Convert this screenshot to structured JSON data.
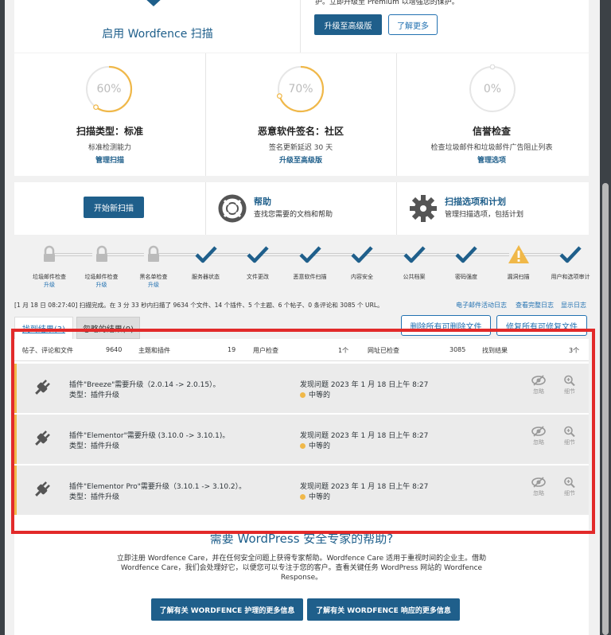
{
  "top": {
    "enable_scan": "启用 Wordfence 扫描",
    "premium_text": "护。立即升级至 Premium 以增强您的保护。",
    "upgrade_btn": "升级至高级版",
    "learn_more_btn": "了解更多"
  },
  "stats": [
    {
      "pct": "60%",
      "value": 0.6,
      "title": "扫描类型：标准",
      "sub": "标准检测能力",
      "link": "管理扫描"
    },
    {
      "pct": "70%",
      "value": 0.7,
      "title": "恶意软件签名：社区",
      "sub": "签名更新延迟 30 天",
      "link": "升级至高级版"
    },
    {
      "pct": "0%",
      "value": 0.0,
      "title": "信誉检查",
      "sub": "检查垃圾邮件和垃圾邮件广告阻止列表",
      "link": "管理选项"
    }
  ],
  "actions": {
    "start_scan": "开始新扫描",
    "help_title": "帮助",
    "help_sub": "查找您需要的文档和帮助",
    "options_title": "扫描选项和计划",
    "options_sub": "管理扫描选项，包括计划"
  },
  "steps": [
    {
      "label": "垃圾邮件检查",
      "sub": "升级",
      "state": "locked"
    },
    {
      "label": "垃圾邮件检查",
      "sub": "升级",
      "state": "locked"
    },
    {
      "label": "黑名单检查",
      "sub": "升级",
      "state": "locked"
    },
    {
      "label": "服务器状态",
      "sub": "",
      "state": "done"
    },
    {
      "label": "文件更改",
      "sub": "",
      "state": "done"
    },
    {
      "label": "恶意软件扫描",
      "sub": "",
      "state": "done"
    },
    {
      "label": "内容安全",
      "sub": "",
      "state": "done"
    },
    {
      "label": "公共档案",
      "sub": "",
      "state": "done"
    },
    {
      "label": "密码强度",
      "sub": "",
      "state": "done"
    },
    {
      "label": "漏洞扫描",
      "sub": "",
      "state": "warning"
    },
    {
      "label": "用户和选项审计",
      "sub": "",
      "state": "done"
    }
  ],
  "log": {
    "summary": "[1 月 18 日 08:27:40] 扫描完成。在 3 分 33 秒内扫描了 9634 个文件、14 个插件、5 个主题、6 个帖子、0 条评论和 3085 个 URL。",
    "email_log": "电子邮件活动日志",
    "full_log": "查看完整日志",
    "show_log": "显示日志"
  },
  "tabs": {
    "found": "找到结果(3)",
    "ignored": "忽略的结果(0)"
  },
  "bulk": {
    "delete": "删除所有可删除文件",
    "repair": "修复所有可修复文件"
  },
  "summary_table": [
    {
      "label": "帖子、评论和文件",
      "value": "9640"
    },
    {
      "label": "主题和插件",
      "value": "19"
    },
    {
      "label": "用户检查",
      "value": "1个"
    },
    {
      "label": "网址已检查",
      "value": "3085"
    },
    {
      "label": "找到结果",
      "value": "3个"
    }
  ],
  "results": [
    {
      "title": "插件\"Breeze\"需要升级（2.0.14 -> 2.0.15）。",
      "type": "类型：插件升级",
      "found": "发现问题 2023 年 1 月 18 日上午 8:27",
      "severity": "中等的",
      "ignore": "忽略",
      "details": "细节"
    },
    {
      "title": "插件\"Elementor\"需要升级 (3.10.0 -> 3.10.1)。",
      "type": "类型：插件升级",
      "found": "发现问题 2023 年 1 月 18 日上午 8:27",
      "severity": "中等的",
      "ignore": "忽略",
      "details": "细节"
    },
    {
      "title": "插件\"Elementor Pro\"需要升级（3.10.1 -> 3.10.2）。",
      "type": "类型：插件升级",
      "found": "发现问题 2023 年 1 月 18 日上午 8:27",
      "severity": "中等的",
      "ignore": "忽略",
      "details": "细节"
    }
  ],
  "care": {
    "heading": "需要 WordPress 安全专家的帮助?",
    "body": "立即注册 Wordfence Care，并在任何安全问题上获得专家帮助。Wordfence Care 适用于重视时间的企业主。借助 Wordfence Care，我们会处理好它，以便您可以专注于您的客户。查看关键任务 WordPress 网站的 Wordfence Response。",
    "care_btn": "了解有关 WORDFENCE 护理的更多信息",
    "response_btn": "了解有关 WORDFENCE 响应的更多信息"
  },
  "colors": {
    "accent": "#1f5f8b",
    "ring": "#f0b849",
    "check": "#1f5f8b",
    "warning": "#f0b849",
    "highlight": "#e22a2a"
  }
}
